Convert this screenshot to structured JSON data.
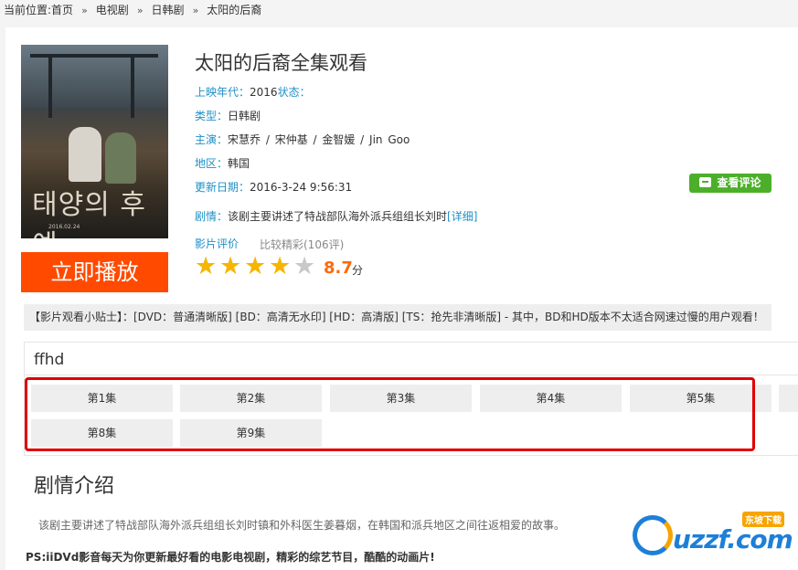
{
  "breadcrumb": {
    "prefix": "当前位置:",
    "items": [
      "首页",
      "电视剧",
      "日韩剧",
      "太阳的后裔"
    ],
    "separator": "»"
  },
  "poster": {
    "title_art": "태양의 후예",
    "caption": "2016.02.24"
  },
  "play_button": "立即播放",
  "movie": {
    "title": "太阳的后裔全集观看",
    "year_label": "上映年代：",
    "year": "2016",
    "status_label": "状态：",
    "status": "",
    "type_label": "类型：",
    "type": "日韩剧",
    "cast_label": "主演：",
    "cast": "宋慧乔 / 宋仲基 / 金智媛 / Jin Goo",
    "region_label": "地区：",
    "region": "韩国",
    "update_label": "更新日期：",
    "update": "2016-3-24 9:56:31",
    "plot_label": "剧情：",
    "plot_short": "该剧主要讲述了特战部队海外派兵组组长刘时",
    "detail_link": "[详细]"
  },
  "review_button": "查看评论",
  "rating": {
    "label": "影片评价",
    "description": "比较精彩(106评)",
    "stars_filled": 4,
    "stars_total": 5,
    "score": "8.7",
    "unit": "分"
  },
  "tips": "【影片观看小贴士】：[DVD：普通清晰版] [BD：高清无水印] [HD：高清版] [TS：抢先非清晰版] - 其中，BD和HD版本不太适合网速过慢的用户观看！",
  "source": {
    "name": "ffhd",
    "episodes": [
      "第1集",
      "第2集",
      "第3集",
      "第4集",
      "第5集",
      "第8集",
      "第9集"
    ]
  },
  "plot_section": {
    "title": "剧情介绍",
    "text": "该剧主要讲述了特战部队海外派兵组组长刘时镇和外科医生姜暮烟，在韩国和派兵地区之间往返相爱的故事。"
  },
  "ps_note": "PS:iiDVd影音每天为你更新最好看的电影电视剧，精彩的综艺节目，酷酷的动画片!",
  "watermark": {
    "text": "uzzf.com",
    "tag": "东坡下载"
  },
  "colors": {
    "accent_blue": "#1e90c8",
    "play_orange": "#ff4a00",
    "review_green": "#4caf2a",
    "highlight_red": "#e00000",
    "score_orange": "#ff6a00"
  }
}
